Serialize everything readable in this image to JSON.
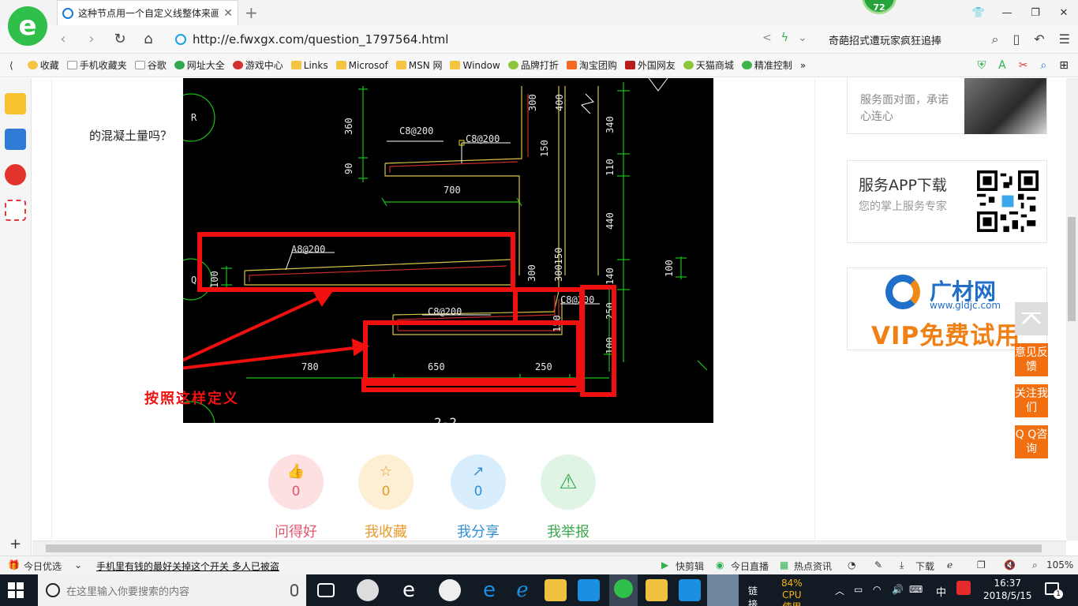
{
  "browser": {
    "tab_title": "这种节点用一个自定义线整体来画",
    "badge_count": "72",
    "url": "http://e.fwxgx.com/question_1797564.html",
    "search_hint": "奇葩招式遭玩家疯狂追捧"
  },
  "bookmarks": [
    "收藏",
    "手机收藏夹",
    "谷歌",
    "网址大全",
    "游戏中心",
    "Links",
    "Microsof",
    "MSN 网",
    "Window",
    "品牌打折",
    "淘宝团购",
    "外国网友",
    "天猫商城",
    "精准控制"
  ],
  "page": {
    "question_tail": "的混凝土量吗？",
    "annotation": "按照这样定义",
    "actions": [
      {
        "label": "问得好",
        "count": "0",
        "icon": "thumbs-up-icon",
        "bg": "#fde0e2",
        "color": "#e8556b"
      },
      {
        "label": "我收藏",
        "count": "0",
        "icon": "star-icon",
        "bg": "#fdefd4",
        "color": "#e79b2b"
      },
      {
        "label": "我分享",
        "count": "0",
        "icon": "share-icon",
        "bg": "#d8eefc",
        "color": "#2f90d6"
      },
      {
        "label": "我举报",
        "count": "",
        "icon": "warning-icon",
        "bg": "#dff4e3",
        "color": "#3ba84e"
      }
    ]
  },
  "cad_labels": {
    "r_marker": "R",
    "q_marker": "Q",
    "rebar1": "C8@200",
    "rebar2": "C8@200",
    "rebar3": "A8@200",
    "rebar4": "C8@200",
    "rebar5": "C8@200",
    "dim_360": "360",
    "dim_90": "90",
    "dim_700": "700",
    "dim_300a": "300",
    "dim_400": "400",
    "dim_150a": "150",
    "dim_340": "340",
    "dim_110": "110",
    "dim_440": "440",
    "dim_140": "140",
    "dim_250": "250",
    "dim_100a": "100",
    "dim_100b": "100",
    "dim_100c": "100",
    "dim_300b": "300",
    "dim_300_150": "300150",
    "dim_150b": "150",
    "dim_780": "780",
    "dim_650": "650",
    "dim_250b": "250",
    "section": "2-2"
  },
  "right": {
    "service_sub": "服务面对面，承诺心连心",
    "app_title": "服务APP下载",
    "app_sub": "您的掌上服务专家",
    "ad_name": "广材网",
    "ad_url": "www.gldjc.com",
    "ad_vip": "VIP免费试用",
    "feedback": "意见反馈",
    "follow": "关注我们",
    "qq": "Q Q咨询"
  },
  "statusbar": {
    "today": "今日优选",
    "news": "手机里有钱的最好关掉这个开关 多人已被盗",
    "clip": "快剪辑",
    "live": "今日直播",
    "hot": "热点资讯",
    "download": "下载",
    "zoom": "105%"
  },
  "taskbar": {
    "search_placeholder": "在这里输入你要搜索的内容",
    "links": "链接",
    "cpu_pct": "84%",
    "cpu_label": "CPU使用",
    "ime": "中",
    "time": "16:37",
    "date": "2018/5/15",
    "notify_count": "1"
  }
}
